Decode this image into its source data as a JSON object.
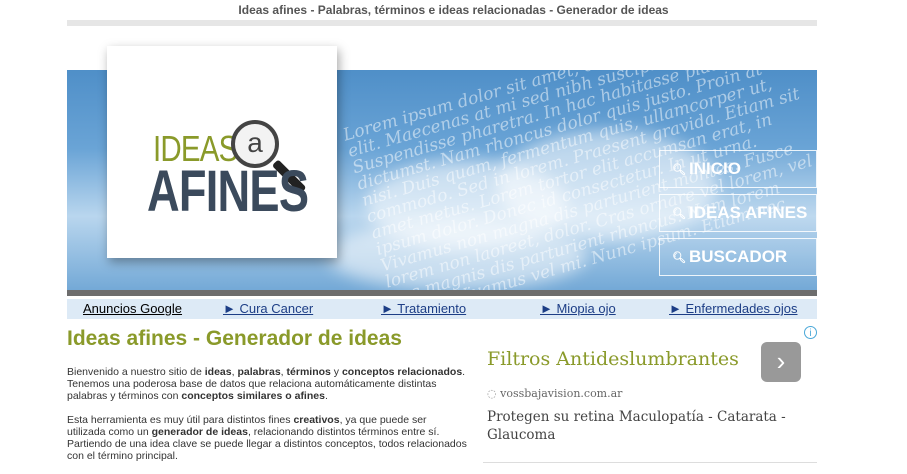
{
  "page": {
    "title": "Ideas afines - Palabras, términos e ideas relacionadas - Generador de ideas"
  },
  "logo": {
    "ideas": "IDEAS",
    "letter": "a",
    "afines": "AFINES"
  },
  "banner": {
    "lorem": "Lorem ipsum dolor sit amet, consectetur adipiscing elit. Maecenas at mi sed nibh suscipit laoreet. Suspendisse pharetra. In hac habitasse platea dictumst. Nam rhoncus dolor quis justo. Proin at nisi. Duis quam, fermentum quis, ullamcorper ut, commodo. Sed in lorem. Praesent gravida. Etiam sit amet metus. Lorem tortor elit accumsan erat, in ipsum dolor. Donec id consectetur. In ut urna. Vivamus non magna dis parturient montes. Fusce lorem non laoreet, dolor. Cras ornare vel lorem, vel hac magnis dis parturient rhoncus. Nam lorem ipsum. Vivamus vel mi. Nunc ipsum. Etiam nec lorem."
  },
  "nav": {
    "items": [
      {
        "label": "INICIO",
        "icon": "search-icon"
      },
      {
        "label": "IDEAS AFINES",
        "icon": "search-icon"
      },
      {
        "label": "BUSCADOR",
        "icon": "search-icon"
      }
    ]
  },
  "adbar": {
    "label": "Anuncios Google",
    "links": [
      "► Cura Cancer",
      "► Tratamiento",
      "► Miopia ojo",
      "► Enfermedades ojos"
    ]
  },
  "main": {
    "heading": "Ideas afines - Generador de ideas",
    "p1": {
      "a": "Bienvenido a nuestro sitio de ",
      "b": "ideas",
      "c": ", ",
      "d": "palabras",
      "e": ", ",
      "f": "términos",
      "g": " y ",
      "h": "conceptos relacionados",
      "i": ".",
      "j": "Tenemos una poderosa base de datos que relaciona automáticamente distintas palabras y términos con ",
      "k": "conceptos similares o afines",
      "l": "."
    },
    "p2": {
      "a": "Esta herramienta es muy útil para distintos fines ",
      "b": "creativos",
      "c": ", ya que puede ser utilizada como un ",
      "d": "generador de ideas",
      "e": ", relacionando distintos términos entre sí. Partiendo de una idea clave se puede llegar a distintos conceptos, todos relacionados con el término principal."
    }
  },
  "ad": {
    "title": "Filtros Antideslumbrantes",
    "arrow": "›",
    "domain": "vossbajavision.com.ar",
    "description": "Protegen su retina Maculopatía - Catarata - Glaucoma",
    "info": "i"
  },
  "colors": {
    "accent": "#8a9a2a",
    "banner_blue": "#5c97cf",
    "link": "#1d3e86",
    "adbar_bg": "#ddeaf6"
  }
}
